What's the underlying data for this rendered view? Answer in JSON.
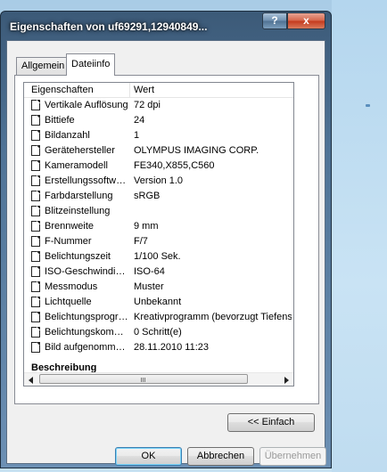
{
  "dialog": {
    "title": "Eigenschaften von uf69291,12940849...",
    "help_label": "?",
    "close_label": "x"
  },
  "tabs": [
    {
      "label": "Allgemein"
    },
    {
      "label": "Dateiinfo"
    }
  ],
  "list": {
    "columns": {
      "property": "Eigenschaften",
      "value": "Wert"
    },
    "rows": [
      {
        "name": "Vertikale Auflösung",
        "value": "72 dpi"
      },
      {
        "name": "Bittiefe",
        "value": "24"
      },
      {
        "name": "Bildanzahl",
        "value": "1"
      },
      {
        "name": "Gerätehersteller",
        "value": "OLYMPUS IMAGING CORP."
      },
      {
        "name": "Kameramodell",
        "value": "FE340,X855,C560"
      },
      {
        "name": "Erstellungssoftware",
        "value": "Version 1.0"
      },
      {
        "name": "Farbdarstellung",
        "value": "sRGB"
      },
      {
        "name": "Blitzeinstellung",
        "value": ""
      },
      {
        "name": "Brennweite",
        "value": "9 mm"
      },
      {
        "name": "F-Nummer",
        "value": "F/7"
      },
      {
        "name": "Belichtungszeit",
        "value": "1/100 Sek."
      },
      {
        "name": "ISO-Geschwindigkeit",
        "value": "ISO-64"
      },
      {
        "name": "Messmodus",
        "value": "Muster"
      },
      {
        "name": "Lichtquelle",
        "value": "Unbekannt"
      },
      {
        "name": "Belichtungsprogra...",
        "value": "Kreativprogramm (bevorzugt Tiefens"
      },
      {
        "name": "Belichtungskompe...",
        "value": "0 Schritt(e)"
      },
      {
        "name": "Bild aufgenomme...",
        "value": "28.11.2010 11:23"
      }
    ],
    "section_heading": "Beschreibung"
  },
  "buttons": {
    "simple": "<< Einfach",
    "ok": "OK",
    "cancel": "Abbrechen",
    "apply": "Übernehmen"
  },
  "icons": {
    "row": "file-icon"
  }
}
